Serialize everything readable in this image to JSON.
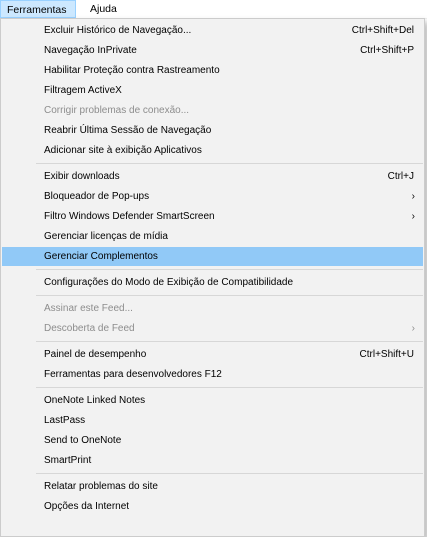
{
  "menubar": {
    "items": [
      {
        "label": "Ferramentas"
      },
      {
        "label": "Ajuda"
      }
    ]
  },
  "menu": {
    "items": [
      {
        "label": "Excluir Histórico de Navegação...",
        "shortcut": "Ctrl+Shift+Del",
        "enabled": true
      },
      {
        "label": "Navegação InPrivate",
        "shortcut": "Ctrl+Shift+P",
        "enabled": true
      },
      {
        "label": "Habilitar Proteção contra Rastreamento",
        "shortcut": "",
        "enabled": true
      },
      {
        "label": "Filtragem ActiveX",
        "shortcut": "",
        "enabled": true
      },
      {
        "label": "Corrigir problemas de conexão...",
        "shortcut": "",
        "enabled": false
      },
      {
        "label": "Reabrir Última Sessão de Navegação",
        "shortcut": "",
        "enabled": true
      },
      {
        "label": "Adicionar site à exibição Aplicativos",
        "shortcut": "",
        "enabled": true
      },
      {
        "label": "Exibir downloads",
        "shortcut": "Ctrl+J",
        "enabled": true
      },
      {
        "label": "Bloqueador de Pop-ups",
        "shortcut": "",
        "submenu": true,
        "enabled": true
      },
      {
        "label": "Filtro Windows Defender SmartScreen",
        "shortcut": "",
        "submenu": true,
        "enabled": true
      },
      {
        "label": "Gerenciar licenças de mídia",
        "shortcut": "",
        "enabled": true
      },
      {
        "label": "Gerenciar Complementos",
        "shortcut": "",
        "enabled": true,
        "highlighted": true
      },
      {
        "label": "Configurações do Modo de Exibição de Compatibilidade",
        "shortcut": "",
        "enabled": true
      },
      {
        "label": "Assinar este Feed...",
        "shortcut": "",
        "enabled": false
      },
      {
        "label": "Descoberta de Feed",
        "shortcut": "",
        "submenu": true,
        "enabled": false
      },
      {
        "label": "Painel de desempenho",
        "shortcut": "Ctrl+Shift+U",
        "enabled": true
      },
      {
        "label": "Ferramentas para desenvolvedores F12",
        "shortcut": "",
        "enabled": true
      },
      {
        "label": "OneNote Linked Notes",
        "shortcut": "",
        "enabled": true
      },
      {
        "label": "LastPass",
        "shortcut": "",
        "enabled": true
      },
      {
        "label": "Send to OneNote",
        "shortcut": "",
        "enabled": true
      },
      {
        "label": "SmartPrint",
        "shortcut": "",
        "enabled": true
      },
      {
        "label": "Relatar problemas do site",
        "shortcut": "",
        "enabled": true
      },
      {
        "label": "Opções da Internet",
        "shortcut": "",
        "enabled": true
      }
    ],
    "submenu_arrow": "›"
  },
  "colors": {
    "highlight": "#91c9f7",
    "disabled_text": "#8d8d8d",
    "menu_bg": "#f2f2f2"
  }
}
